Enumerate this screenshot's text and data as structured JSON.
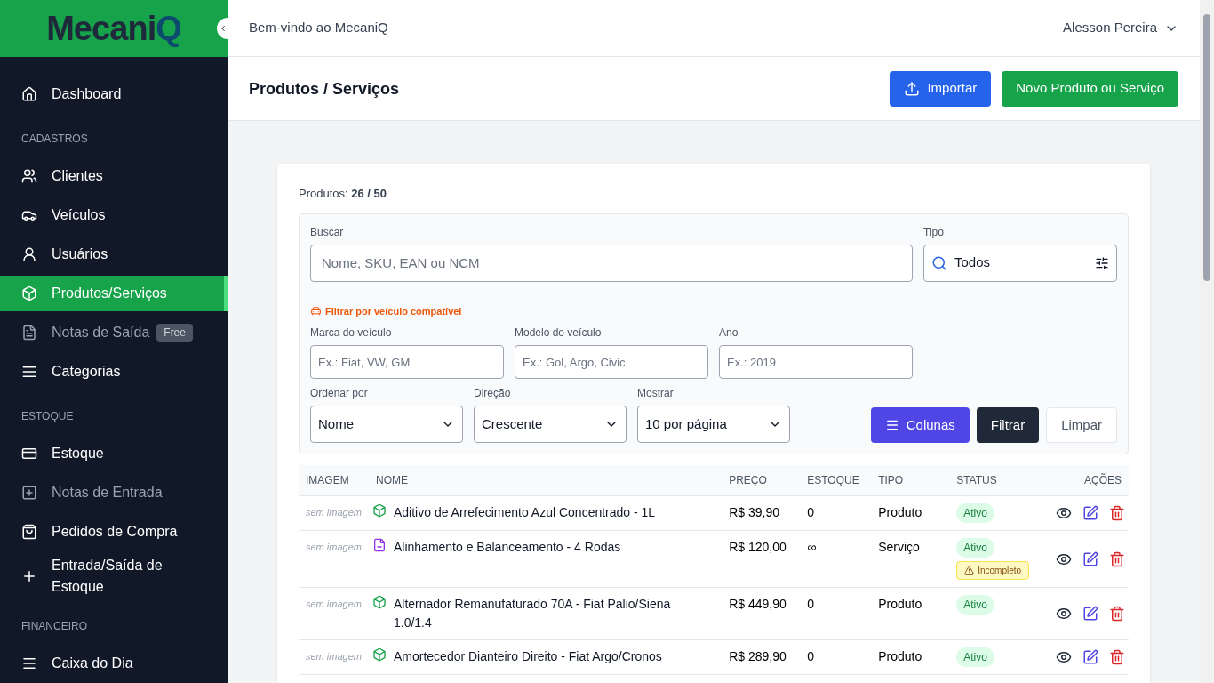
{
  "sidebar": {
    "logo": "Mecani",
    "logo_end": "Q",
    "items": [
      {
        "kind": "item",
        "label": "Dashboard",
        "selected": false,
        "disabled": false
      },
      {
        "kind": "heading",
        "label": "CADASTROS"
      },
      {
        "kind": "item",
        "label": "Clientes",
        "selected": false,
        "disabled": false
      },
      {
        "kind": "item",
        "label": "Veículos",
        "selected": false,
        "disabled": false
      },
      {
        "kind": "item",
        "label": "Usuários",
        "selected": false,
        "disabled": false
      },
      {
        "kind": "item",
        "label": "Produtos/Serviços",
        "selected": true,
        "disabled": false
      },
      {
        "kind": "item",
        "label": "Notas de Saída",
        "selected": false,
        "disabled": true,
        "badge": "Free"
      },
      {
        "kind": "item",
        "label": "Categorias",
        "selected": false,
        "disabled": false
      },
      {
        "kind": "heading",
        "label": "ESTOQUE"
      },
      {
        "kind": "item",
        "label": "Estoque",
        "selected": false,
        "disabled": false
      },
      {
        "kind": "item",
        "label": "Notas de Entrada",
        "selected": false,
        "disabled": true
      },
      {
        "kind": "item",
        "label": "Pedidos de Compra",
        "selected": false,
        "disabled": false
      },
      {
        "kind": "item",
        "label": "Entrada/Saída de Estoque",
        "selected": false,
        "disabled": false
      },
      {
        "kind": "heading",
        "label": "FINANCEIRO"
      },
      {
        "kind": "item",
        "label": "Caixa do Dia",
        "selected": false,
        "disabled": false
      }
    ]
  },
  "topbar": {
    "welcome": "Bem-vindo ao MecaniQ",
    "user": "Alesson Pereira"
  },
  "header": {
    "title": "Produtos / Serviços",
    "buttons": [
      {
        "kind": "import",
        "label": "Importar"
      },
      {
        "kind": "new",
        "label": "Novo Produto ou Serviço"
      }
    ]
  },
  "summary": {
    "label": "Produtos:",
    "value": "26 / 50"
  },
  "filters": {
    "search": {
      "label": "Buscar",
      "placeholder": "Nome, SKU, EAN ou NCM"
    },
    "type": {
      "label": "Tipo",
      "value": "Todos"
    },
    "vehicle_filter": "Filtrar por veículo compatível",
    "vehicle_fields": [
      {
        "label": "Marca do veículo",
        "placeholder": "Ex.: Fiat, VW, GM"
      },
      {
        "label": "Modelo do veículo",
        "placeholder": "Ex.: Gol, Argo, Civic"
      },
      {
        "label": "Ano",
        "placeholder": "Ex.: 2019"
      }
    ],
    "selects": [
      {
        "label": "Ordenar por",
        "value": "Nome"
      },
      {
        "label": "Direção",
        "value": "Crescente"
      },
      {
        "label": "Mostrar",
        "value": "10 por página"
      }
    ],
    "buttons": [
      {
        "kind": "columns",
        "label": "Colunas"
      },
      {
        "kind": "filter",
        "label": "Filtrar"
      },
      {
        "kind": "clear",
        "label": "Limpar"
      }
    ]
  },
  "table": {
    "columns": [
      "IMAGEM",
      "NOME",
      "PREÇO",
      "ESTOQUE",
      "TIPO",
      "STATUS",
      "AÇÕES"
    ],
    "rows": [
      {
        "image": "sem imagem",
        "kind": "produto",
        "name": "Aditivo de Arrefecimento Azul Concentrado - 1L",
        "price": "R$ 39,90",
        "stock": "0",
        "type": "Produto",
        "status": "Ativo"
      },
      {
        "image": "sem imagem",
        "kind": "servico",
        "name": "Alinhamento e Balanceamento - 4 Rodas",
        "price": "R$ 120,00",
        "stock": "∞",
        "type": "Serviço",
        "status": "Ativo",
        "warning": "Incompleto"
      },
      {
        "image": "sem imagem",
        "kind": "produto",
        "name": "Alternador Remanufaturado 70A - Fiat Palio/Siena 1.0/1.4",
        "price": "R$ 449,90",
        "stock": "0",
        "type": "Produto",
        "status": "Ativo"
      },
      {
        "image": "sem imagem",
        "kind": "produto",
        "name": "Amortecedor Dianteiro Direito - Fiat Argo/Cronos",
        "price": "R$ 289,90",
        "stock": "0",
        "type": "Produto",
        "status": "Ativo"
      }
    ]
  }
}
